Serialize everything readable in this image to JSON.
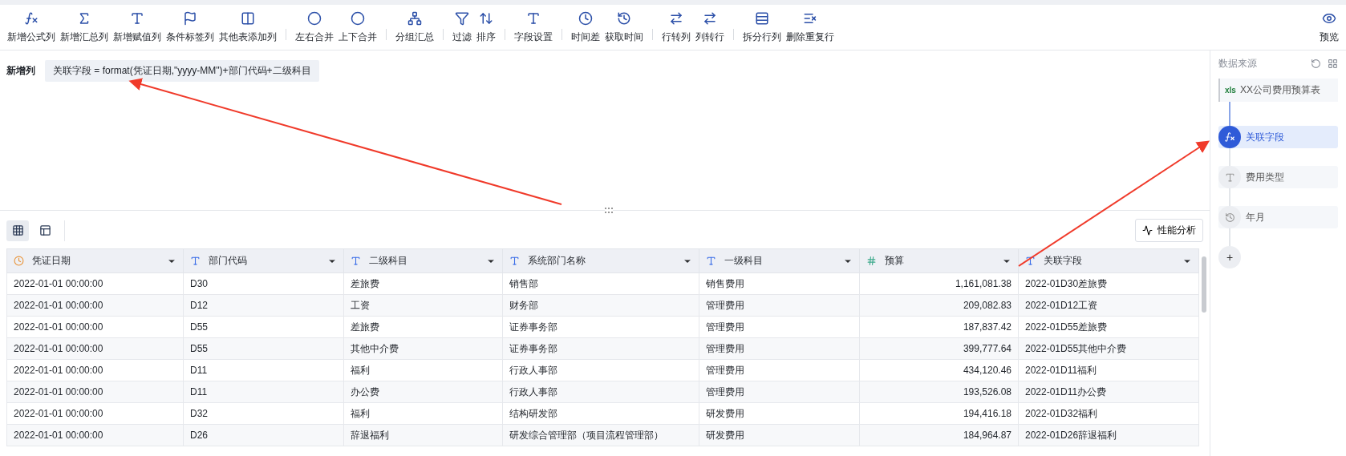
{
  "toolbar": {
    "groups": [
      [
        {
          "label": "新增公式列"
        },
        {
          "label": "新增汇总列"
        },
        {
          "label": "新增赋值列"
        },
        {
          "label": "条件标签列"
        },
        {
          "label": "其他表添加列"
        }
      ],
      [
        {
          "label": "左右合并"
        },
        {
          "label": "上下合并"
        }
      ],
      [
        {
          "label": "分组汇总"
        }
      ],
      [
        {
          "label": "过滤"
        },
        {
          "label": "排序"
        }
      ],
      [
        {
          "label": "字段设置"
        }
      ],
      [
        {
          "label": "时间差"
        },
        {
          "label": "获取时间"
        }
      ],
      [
        {
          "label": "行转列"
        },
        {
          "label": "列转行"
        }
      ],
      [
        {
          "label": "拆分行列"
        },
        {
          "label": "删除重复行"
        }
      ]
    ],
    "preview": {
      "label": "预览"
    }
  },
  "editor": {
    "label": "新增列",
    "formula": "关联字段 = format(凭证日期,\"yyyy-MM\")+部门代码+二级科目"
  },
  "view_toggle": [
    {
      "kind": "grid",
      "selected": true
    },
    {
      "kind": "layout",
      "selected": false
    }
  ],
  "analysis_button": {
    "label": "性能分析"
  },
  "table": {
    "columns": [
      {
        "label": "凭证日期",
        "kind": "date"
      },
      {
        "label": "部门代码",
        "kind": "text"
      },
      {
        "label": "二级科目",
        "kind": "text"
      },
      {
        "label": "系统部门名称",
        "kind": "text"
      },
      {
        "label": "一级科目",
        "kind": "text"
      },
      {
        "label": "预算",
        "kind": "number"
      },
      {
        "label": "关联字段",
        "kind": "text"
      }
    ],
    "rows": [
      [
        "2022-01-01 00:00:00",
        "D30",
        "差旅费",
        "销售部",
        "销售费用",
        "1,161,081.38",
        "2022-01D30差旅费"
      ],
      [
        "2022-01-01 00:00:00",
        "D12",
        "工资",
        "财务部",
        "管理费用",
        "209,082.83",
        "2022-01D12工资"
      ],
      [
        "2022-01-01 00:00:00",
        "D55",
        "差旅费",
        "证券事务部",
        "管理费用",
        "187,837.42",
        "2022-01D55差旅费"
      ],
      [
        "2022-01-01 00:00:00",
        "D55",
        "其他中介费",
        "证券事务部",
        "管理费用",
        "399,777.64",
        "2022-01D55其他中介费"
      ],
      [
        "2022-01-01 00:00:00",
        "D11",
        "福利",
        "行政人事部",
        "管理费用",
        "434,120.46",
        "2022-01D11福利"
      ],
      [
        "2022-01-01 00:00:00",
        "D11",
        "办公费",
        "行政人事部",
        "管理费用",
        "193,526.08",
        "2022-01D11办公费"
      ],
      [
        "2022-01-01 00:00:00",
        "D32",
        "福利",
        "结构研发部",
        "研发费用",
        "194,416.18",
        "2022-01D32福利"
      ],
      [
        "2022-01-01 00:00:00",
        "D26",
        "辞退福利",
        "研发综合管理部（项目流程管理部）",
        "研发费用",
        "184,964.87",
        "2022-01D26辞退福利"
      ]
    ]
  },
  "sidebar": {
    "title": "数据来源",
    "source": {
      "badge": "xls",
      "name": "XX公司费用预算表"
    },
    "steps": [
      {
        "label": "关联字段",
        "kind": "formula",
        "selected": true
      },
      {
        "label": "费用类型",
        "kind": "assign",
        "selected": false
      },
      {
        "label": "年月",
        "kind": "time",
        "selected": false
      }
    ],
    "add_label": "+"
  }
}
